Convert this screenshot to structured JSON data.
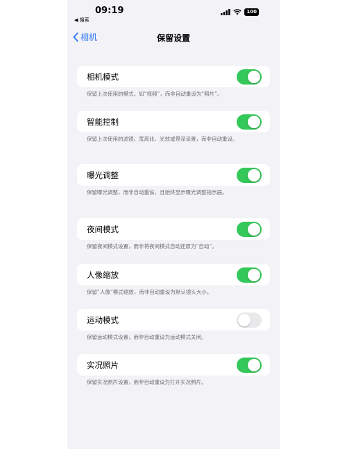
{
  "status_bar": {
    "time": "09:19",
    "back_app": "◀ 搜索",
    "battery": "100"
  },
  "nav": {
    "back_label": "相机",
    "title": "保留设置"
  },
  "settings": [
    {
      "label": "相机模式",
      "enabled": true,
      "footer": "保留上次使用的模式，如“视频”，而非自动重设为“照片”。"
    },
    {
      "label": "智能控制",
      "enabled": true,
      "footer": "保留上次使用的滤镜、宽高比、光效或景深设置，而非自动重设。"
    },
    {
      "label": "曝光调整",
      "enabled": true,
      "footer": "保留曝光调整，而非自动重设，且始终显示曝光调整指示器。"
    },
    {
      "label": "夜间模式",
      "enabled": true,
      "footer": "保留夜间模式设置，而非将夜间模式自动还原为“自动”。"
    },
    {
      "label": "人像缩放",
      "enabled": true,
      "footer": "保留“人像”模式缩放，而非自动重设为默认镜头大小。"
    },
    {
      "label": "运动模式",
      "enabled": false,
      "footer": "保留运动模式设置，而非自动重设为运动模式关闭。"
    },
    {
      "label": "实况照片",
      "enabled": true,
      "footer": "保留实况照片设置，而非自动重设为打开实况照片。"
    }
  ],
  "colors": {
    "accent": "#3478f6",
    "toggle_on": "#34c759",
    "toggle_off": "#e9e9eb",
    "background": "#f2f2f7"
  },
  "icons": {
    "back": "chevron-left-icon",
    "signal": "cellular-signal-icon",
    "wifi": "wifi-icon",
    "battery": "battery-icon"
  }
}
